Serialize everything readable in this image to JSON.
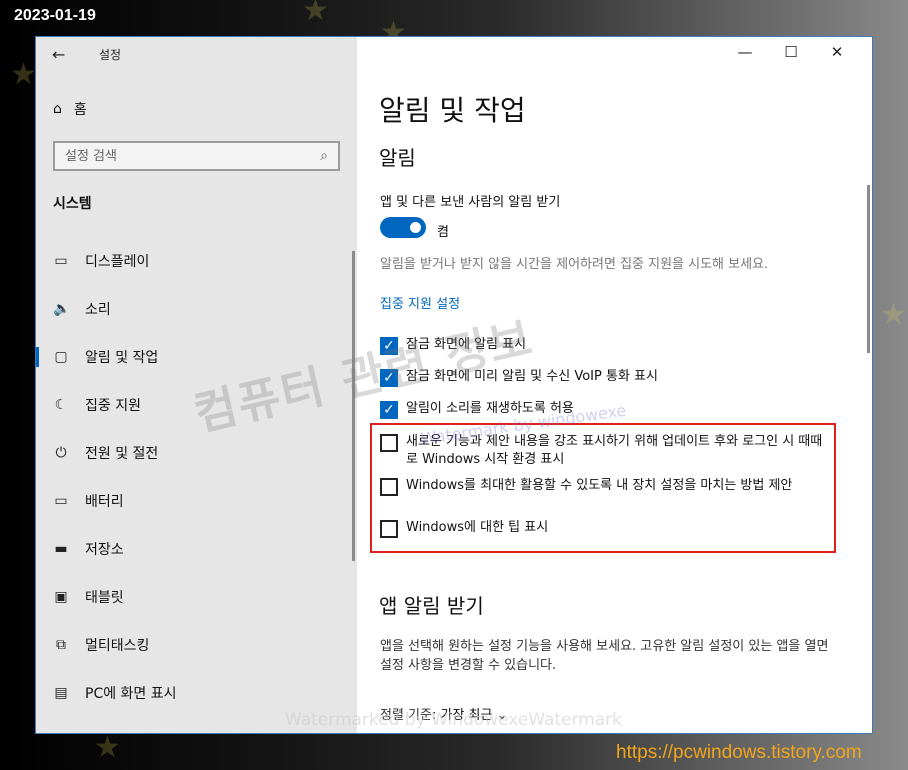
{
  "overlay": {
    "date": "2023-01-19",
    "site": "https://pcwindows.tistory.com",
    "watermark_kr": "컴퓨터 관련 정보",
    "watermark_small": "Watermark by windowexe",
    "watermark_bottom": "Watermarked by WindowexeWatermark"
  },
  "window": {
    "app_title": "설정",
    "controls": [
      "minimize-icon",
      "maximize-icon",
      "close-icon"
    ]
  },
  "sidebar": {
    "home_label": "홈",
    "search_placeholder": "설정 검색",
    "section_title": "시스템",
    "items": [
      {
        "label": "디스플레이",
        "icon": "monitor-icon"
      },
      {
        "label": "소리",
        "icon": "speaker-icon"
      },
      {
        "label": "알림 및 작업",
        "icon": "notification-icon",
        "active": true
      },
      {
        "label": "집중 지원",
        "icon": "moon-icon"
      },
      {
        "label": "전원 및 절전",
        "icon": "power-icon"
      },
      {
        "label": "배터리",
        "icon": "battery-icon"
      },
      {
        "label": "저장소",
        "icon": "storage-icon"
      },
      {
        "label": "태블릿",
        "icon": "tablet-icon"
      },
      {
        "label": "멀티태스킹",
        "icon": "multitasking-icon"
      },
      {
        "label": "PC에 화면 표시",
        "icon": "project-icon"
      }
    ]
  },
  "main": {
    "page_title": "알림 및 작업",
    "section_notifications": "알림",
    "get_notifications_label": "앱 및 다른 보낸 사람의 알림 받기",
    "toggle_state": "켬",
    "focus_desc": "알림을 받거나 받지 않을 시간을 제어하려면 집중 지원을 시도해 보세요.",
    "focus_link": "집중 지원 설정",
    "checkboxes": [
      {
        "label": "잠금 화면에 알림 표시",
        "checked": true
      },
      {
        "label": "잠금 화면에 미리 알림 및 수신 VoIP 통화 표시",
        "checked": true
      },
      {
        "label": "알림이 소리를 재생하도록 허용",
        "checked": true
      },
      {
        "label": "새로운 기능과 제안 내용을 강조 표시하기 위해 업데이트 후와 로그인 시 때때로 Windows 시작 환경 표시",
        "checked": false
      },
      {
        "label": "Windows를 최대한 활용할 수 있도록 내 장치 설정을 마치는 방법 제안",
        "checked": false
      },
      {
        "label": "Windows에 대한 팁 표시",
        "checked": false
      }
    ],
    "section_app_notifications": "앱 알림 받기",
    "app_desc": "앱을 선택해 원하는 설정 기능을 사용해 보세요. 고유한 알림 설정이 있는 앱을 열면 설정 사항을 변경할 수 있습니다.",
    "sort_label": "정렬 기준:",
    "sort_value": "가장 최근"
  },
  "colors": {
    "accent": "#0067c0",
    "highlight_border": "#e02020",
    "site_text": "#f2a51a"
  }
}
